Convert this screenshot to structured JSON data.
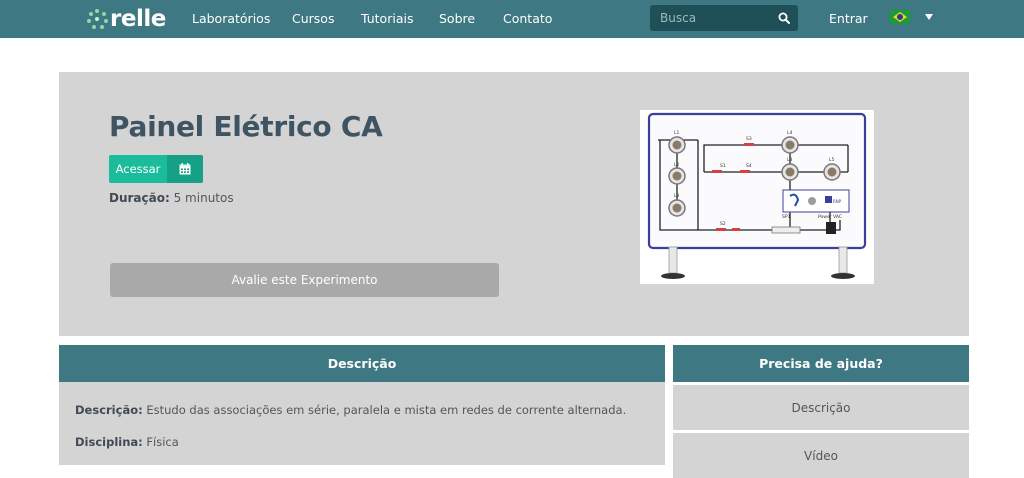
{
  "nav": {
    "brand": "relle",
    "links": [
      "Laboratórios",
      "Cursos",
      "Tutoriais",
      "Sobre",
      "Contato"
    ],
    "search_placeholder": "Busca",
    "login": "Entrar",
    "language_flag": "brazil-flag-icon"
  },
  "experiment": {
    "title": "Painel Elétrico CA",
    "access_label": "Acessar",
    "duration_label": "Duração:",
    "duration_value": "5 minutos",
    "rate_label": "Avalie este Experimento",
    "panel_labels": {
      "l1": "L1",
      "l2": "L2",
      "l3": "L3",
      "l4": "L4",
      "l5": "L5",
      "s1": "S1",
      "s2": "S2",
      "s3": "S3",
      "s4": "S4",
      "sp1": "SP1",
      "power": "Power VAC",
      "rnp": "RNP"
    }
  },
  "description": {
    "header": "Descrição",
    "desc_label": "Descrição:",
    "desc_value": "Estudo das associações em série, paralela e mista em redes de corrente alternada.",
    "discipline_label": "Disciplina:",
    "discipline_value": "Física"
  },
  "help": {
    "header": "Precisa de ajuda?",
    "items": [
      "Descrição",
      "Vídeo"
    ]
  },
  "colors": {
    "nav_bg": "#3e7882",
    "accent_green": "#1bbc9b",
    "panel_bg": "#d4d4d4"
  }
}
